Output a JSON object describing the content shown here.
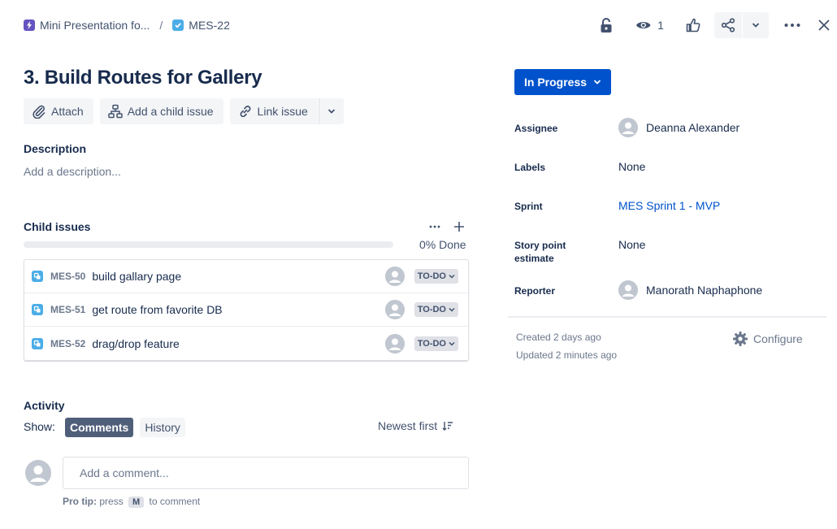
{
  "breadcrumb": {
    "project": "Mini Presentation fo...",
    "separator": "/",
    "issue_key": "MES-22"
  },
  "header": {
    "watch_count": "1"
  },
  "issue": {
    "title": "3. Build Routes for Gallery"
  },
  "toolbar": {
    "attach_label": "Attach",
    "add_child_label": "Add a child issue",
    "link_label": "Link issue"
  },
  "description": {
    "heading": "Description",
    "placeholder": "Add a description..."
  },
  "child_issues": {
    "heading": "Child issues",
    "progress": 0,
    "progress_label": "0% Done",
    "items": [
      {
        "key": "MES-50",
        "summary": "build gallary page",
        "status": "TO-DO"
      },
      {
        "key": "MES-51",
        "summary": "get route from favorite DB",
        "status": "TO-DO"
      },
      {
        "key": "MES-52",
        "summary": "drag/drop feature",
        "status": "TO-DO"
      }
    ]
  },
  "activity": {
    "heading": "Activity",
    "show_label": "Show:",
    "tab_comments": "Comments",
    "tab_history": "History",
    "sort_label": "Newest first",
    "comment_placeholder": "Add a comment...",
    "pro_tip_label": "Pro tip:",
    "pro_tip_press": "press",
    "pro_tip_key": "M",
    "pro_tip_suffix": "to comment"
  },
  "details": {
    "status": "In Progress",
    "assignee_label": "Assignee",
    "assignee_value": "Deanna Alexander",
    "labels_label": "Labels",
    "labels_value": "None",
    "sprint_label": "Sprint",
    "sprint_value": "MES Sprint 1 - MVP",
    "story_points_label_1": "Story point",
    "story_points_label_2": "estimate",
    "story_points_value": "None",
    "reporter_label": "Reporter",
    "reporter_value": "Manorath Naphaphone"
  },
  "meta": {
    "created": "Created 2 days ago",
    "updated": "Updated 2 minutes ago",
    "configure_label": "Configure"
  },
  "colors": {
    "brand_blue": "#0052cc",
    "epic_purple": "#6554c0",
    "subtask_blue": "#4bade8",
    "story_check": "#4bade8"
  }
}
